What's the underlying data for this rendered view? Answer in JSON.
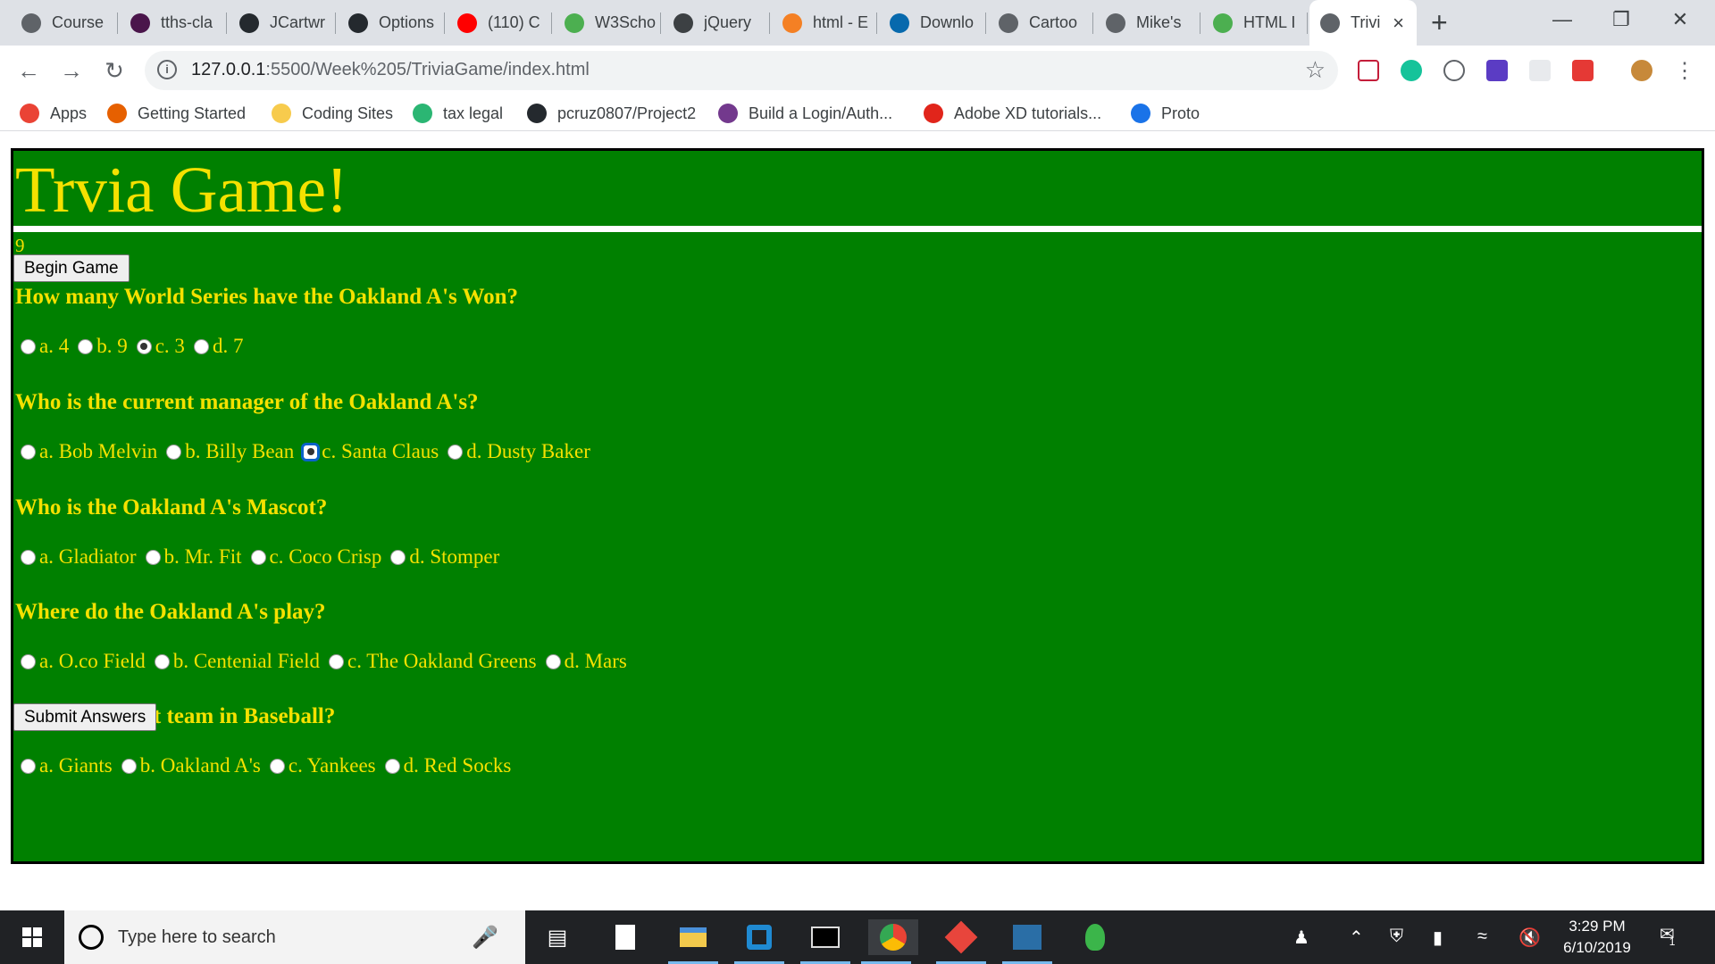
{
  "browser": {
    "tabs": [
      {
        "title": "Course",
        "icon": "globe-icon",
        "color": "#5f6368"
      },
      {
        "title": "tths-cla",
        "icon": "slack-icon",
        "color": "#4a154b"
      },
      {
        "title": "JCartwr",
        "icon": "github-icon",
        "color": "#24292e"
      },
      {
        "title": "Options",
        "icon": "github-icon",
        "color": "#24292e"
      },
      {
        "title": "(110) C",
        "icon": "youtube-icon",
        "color": "#ff0000"
      },
      {
        "title": "W3Scho",
        "icon": "w3schools-icon",
        "color": "#4caf50"
      },
      {
        "title": "jQuery",
        "icon": "jquery-icon",
        "color": "#3c4043"
      },
      {
        "title": "html - E",
        "icon": "stackoverflow-icon",
        "color": "#f48024"
      },
      {
        "title": "Downlo",
        "icon": "jquery-icon",
        "color": "#0769ad"
      },
      {
        "title": "Cartoo",
        "icon": "globe-icon",
        "color": "#5f6368"
      },
      {
        "title": "Mike's",
        "icon": "globe-icon",
        "color": "#5f6368"
      },
      {
        "title": "HTML I",
        "icon": "w3schools-icon",
        "color": "#4caf50"
      },
      {
        "title": "Trivi",
        "icon": "globe-icon",
        "color": "#5f6368",
        "active": true
      }
    ],
    "url_host": "127.0.0.1",
    "url_path": ":5500/Week%205/TriviaGame/index.html",
    "bookmarks": [
      {
        "label": "Apps",
        "icon": "apps-grid-icon",
        "color": "#ea4335"
      },
      {
        "label": "Getting Started",
        "icon": "firefox-icon",
        "color": "#e66000"
      },
      {
        "label": "Coding Sites",
        "icon": "folder-icon",
        "color": "#f7cb4d"
      },
      {
        "label": "tax legal",
        "icon": "ck-icon",
        "color": "#2bb673"
      },
      {
        "label": "pcruz0807/Project2",
        "icon": "github-icon",
        "color": "#24292e"
      },
      {
        "label": "Build a Login/Auth...",
        "icon": "bit-icon",
        "color": "#73398d"
      },
      {
        "label": "Adobe XD tutorials...",
        "icon": "adobe-icon",
        "color": "#e1251b"
      },
      {
        "label": "Proto",
        "icon": "proto-icon",
        "color": "#1a73e8"
      }
    ]
  },
  "game": {
    "title": "Trvia Game!",
    "timer": "9",
    "begin_label": "Begin Game",
    "submit_label": "Submit Answers",
    "questions": [
      {
        "q": "How many World Series have the Oakland A's Won?",
        "options": [
          "a. 4",
          "b. 9",
          "c. 3",
          "d. 7"
        ],
        "selected": 2
      },
      {
        "q": "Who is the current manager of the Oakland A's?",
        "options": [
          "a. Bob Melvin",
          "b. Billy Bean",
          "c. Santa Claus",
          "d. Dusty Baker"
        ],
        "selected": 2
      },
      {
        "q": "Who is the Oakland A's Mascot?",
        "options": [
          "a. Gladiator",
          "b. Mr. Fit",
          "c. Coco Crisp",
          "d. Stomper"
        ],
        "selected": null
      },
      {
        "q": "Where do the Oakland A's play?",
        "options": [
          "a. O.co Field",
          "b. Centenial Field",
          "c. The Oakland Greens",
          "d. Mars"
        ],
        "selected": null
      },
      {
        "q": "Who is the best team in Baseball?",
        "options": [
          "a. Giants",
          "b. Oakland A's",
          "c. Yankees",
          "d. Red Socks"
        ],
        "selected": null
      }
    ],
    "colors": {
      "background": "#008000",
      "text": "#f5e100"
    }
  },
  "taskbar": {
    "search_placeholder": "Type here to search",
    "time": "3:29 PM",
    "date": "6/10/2019",
    "notification_count": "1"
  }
}
